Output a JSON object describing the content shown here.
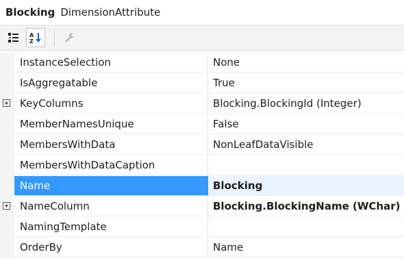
{
  "header": {
    "object_name": "Blocking",
    "object_type": "DimensionAttribute"
  },
  "toolbar": {
    "categorized_icon": "categorized-icon",
    "alphabetical_icon": "alphabetical-az-icon",
    "property_pages_icon": "wrench-icon"
  },
  "properties": [
    {
      "name": "InstanceSelection",
      "value": "None",
      "expandable": false,
      "bold": false,
      "selected": false
    },
    {
      "name": "IsAggregatable",
      "value": "True",
      "expandable": false,
      "bold": false,
      "selected": false
    },
    {
      "name": "KeyColumns",
      "value": "Blocking.BlockingId (Integer)",
      "expandable": true,
      "bold": false,
      "selected": false
    },
    {
      "name": "MemberNamesUnique",
      "value": "False",
      "expandable": false,
      "bold": false,
      "selected": false
    },
    {
      "name": "MembersWithData",
      "value": "NonLeafDataVisible",
      "expandable": false,
      "bold": false,
      "selected": false
    },
    {
      "name": "MembersWithDataCaption",
      "value": "",
      "expandable": false,
      "bold": false,
      "selected": false
    },
    {
      "name": "Name",
      "value": "Blocking",
      "expandable": false,
      "bold": true,
      "selected": true
    },
    {
      "name": "NameColumn",
      "value": "Blocking.BlockingName (WChar)",
      "expandable": true,
      "bold": true,
      "selected": false
    },
    {
      "name": "NamingTemplate",
      "value": "",
      "expandable": false,
      "bold": false,
      "selected": false
    },
    {
      "name": "OrderBy",
      "value": "Name",
      "expandable": false,
      "bold": false,
      "selected": false
    }
  ],
  "colors": {
    "selection": "#3399ff",
    "toolbar_bg": "#f3f3f3",
    "gutter_bg": "#f5f5f5"
  }
}
